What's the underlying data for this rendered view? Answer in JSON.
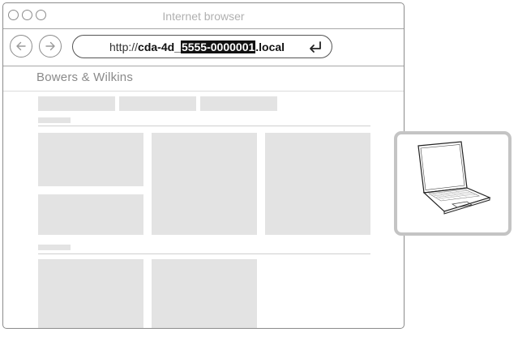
{
  "window": {
    "title": "Internet browser"
  },
  "address_bar": {
    "url_prefix": "http://",
    "url_host_start": "cda-4d_",
    "url_serial_highlighted": "5555-0000001",
    "url_suffix": ".local"
  },
  "site": {
    "logo_text": "Bowers & Wilkins"
  },
  "icons": {
    "back": "arrow-left-icon",
    "forward": "arrow-right-icon",
    "enter": "return-enter-icon",
    "device": "laptop-icon"
  },
  "colors": {
    "placeholder_block": "#e3e3e3",
    "highlight": "#111111",
    "frame_border": "#c4c4c4"
  }
}
